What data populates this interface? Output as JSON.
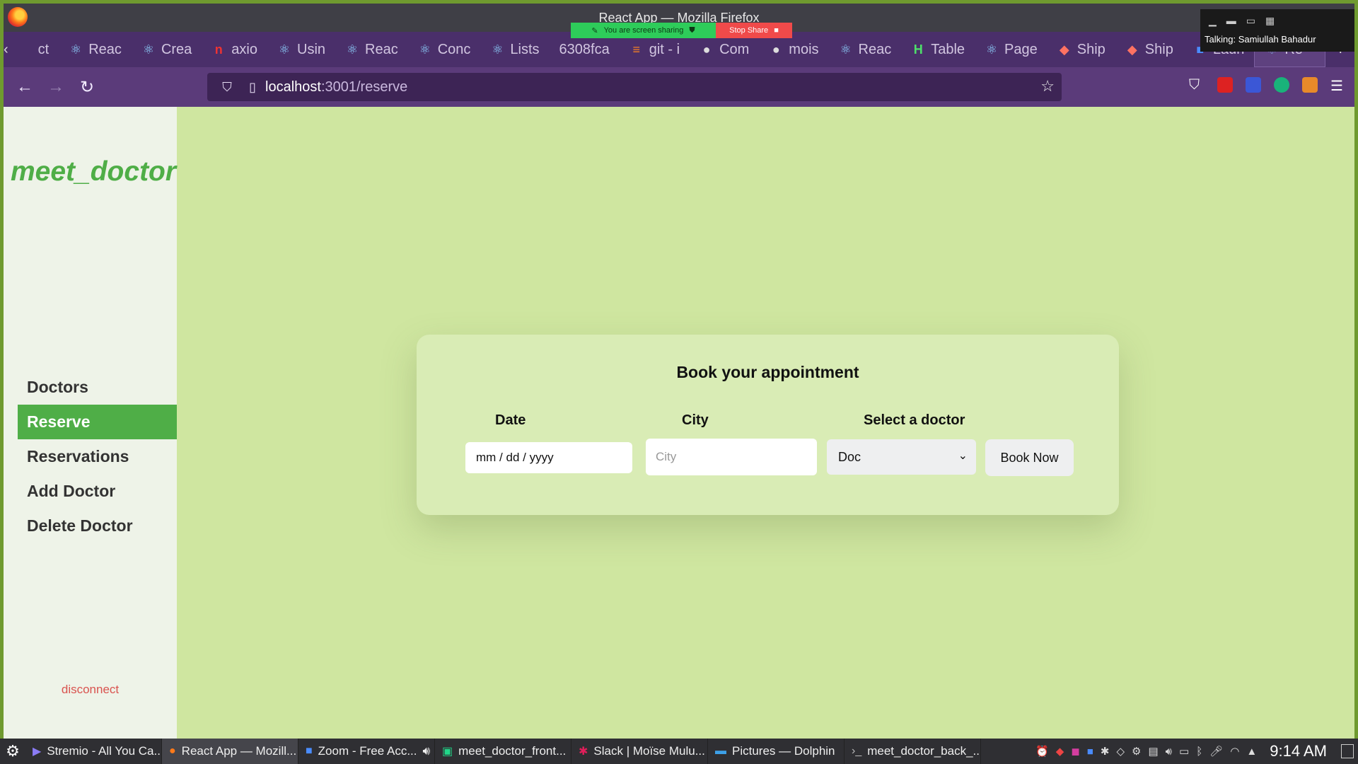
{
  "window": {
    "title": "React App — Mozilla Firefox"
  },
  "screen_share": {
    "status": "You are screen sharing",
    "stop_label": "Stop Share"
  },
  "zoom_mini": {
    "talking": "Talking: Samiullah Bahadur"
  },
  "tabs": [
    {
      "label": "ct",
      "icon": "react-icon"
    },
    {
      "label": "Reac",
      "icon": "react-icon"
    },
    {
      "label": "Crea",
      "icon": "react-icon"
    },
    {
      "label": "axio",
      "icon": "npm-icon"
    },
    {
      "label": "Usin",
      "icon": "react-icon"
    },
    {
      "label": "Reac",
      "icon": "react-icon"
    },
    {
      "label": "Conc",
      "icon": "react-icon"
    },
    {
      "label": "Lists",
      "icon": "react-icon"
    },
    {
      "label": "6308fca",
      "icon": ""
    },
    {
      "label": "git - i",
      "icon": "stackoverflow-icon"
    },
    {
      "label": "Com",
      "icon": "github-icon"
    },
    {
      "label": "mois",
      "icon": "github-icon"
    },
    {
      "label": "Reac",
      "icon": "react-icon"
    },
    {
      "label": "Table",
      "icon": "h-icon"
    },
    {
      "label": "Page",
      "icon": "react-icon"
    },
    {
      "label": "Ship",
      "icon": "figma-icon"
    },
    {
      "label": "Ship",
      "icon": "figma-icon"
    },
    {
      "label": "Laun",
      "icon": "zoom-icon"
    },
    {
      "label": "Re",
      "icon": "react-icon",
      "active": true
    }
  ],
  "nav": {
    "url_host": "localhost",
    "url_path": ":3001/reserve"
  },
  "app": {
    "brand": "meet_doctor",
    "menu": [
      {
        "label": "Doctors"
      },
      {
        "label": "Reserve",
        "active": true
      },
      {
        "label": "Reservations"
      },
      {
        "label": "Add Doctor"
      },
      {
        "label": "Delete Doctor"
      }
    ],
    "disconnect": "disconnect"
  },
  "form": {
    "title": "Book your appointment",
    "date_label": "Date",
    "date_value": "mm / dd / yyyy",
    "city_label": "City",
    "city_placeholder": "City",
    "doctor_label": "Select a doctor",
    "doctor_value": "Doc",
    "submit": "Book Now"
  },
  "taskbar": {
    "tasks": [
      {
        "label": "Stremio - All You Ca...",
        "icon": "stremio-icon"
      },
      {
        "label": "React App — Mozill...",
        "icon": "firefox-icon",
        "active": true
      },
      {
        "label": "Zoom - Free Acc...",
        "icon": "zoom-icon"
      },
      {
        "label": "meet_doctor_front...",
        "icon": "webstorm-icon"
      },
      {
        "label": "Slack | Moïse Mulu...",
        "icon": "slack-icon"
      },
      {
        "label": "Pictures — Dolphin",
        "icon": "folder-icon"
      },
      {
        "label": "meet_doctor_back_...",
        "icon": "terminal-icon"
      }
    ],
    "clock": "9:14 AM"
  },
  "colors": {
    "page_bg": "#cfe6a0",
    "sidebar_bg": "#eef3e8",
    "accent_green": "#4fae47",
    "card_bg": "#d9ecb5",
    "disconnect_red": "#d9534f"
  }
}
